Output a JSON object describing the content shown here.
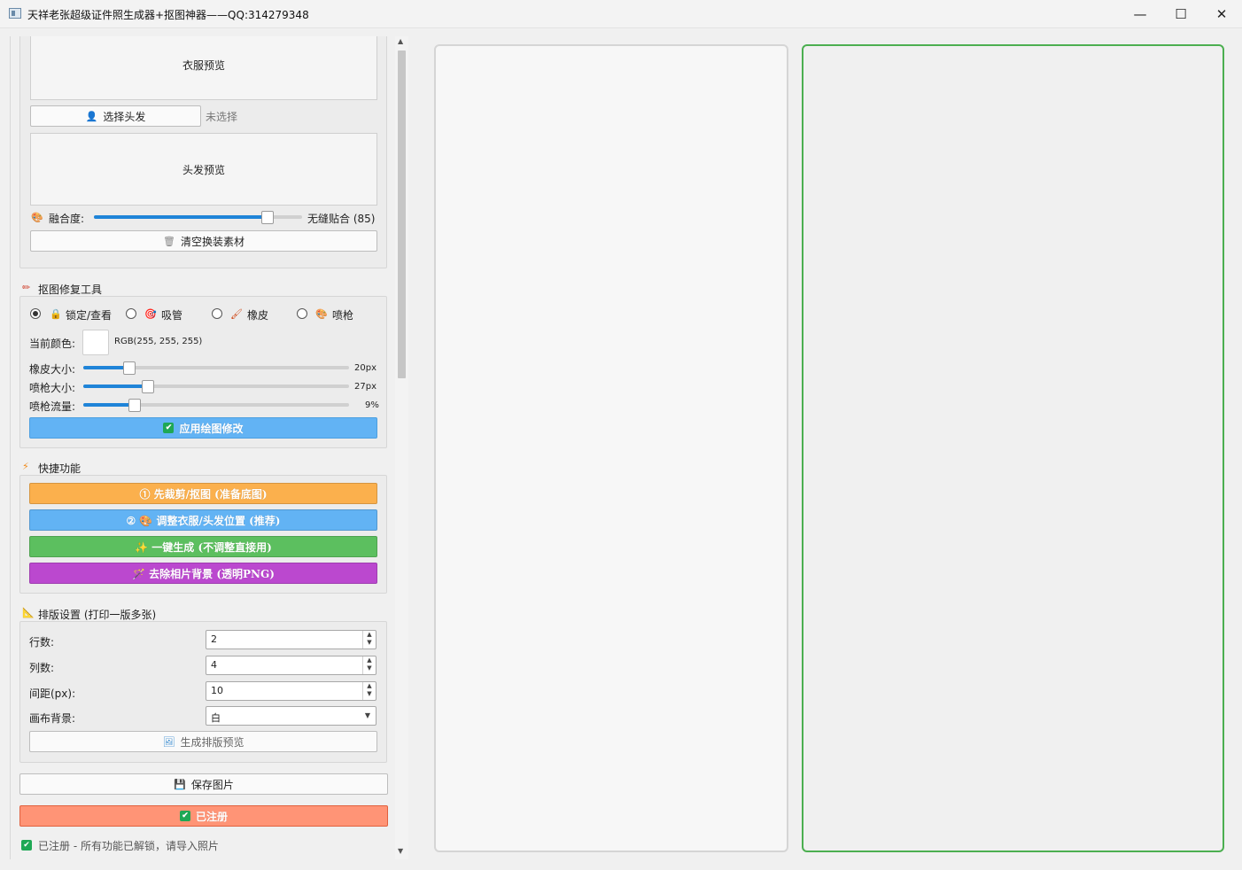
{
  "window": {
    "title": "天祥老张超级证件照生成器+抠图神器——QQ:314279348",
    "minimize": "—",
    "maximize": "☐",
    "close": "✕"
  },
  "clothes": {
    "preview_label": "衣服预览"
  },
  "hair": {
    "select_button": "选择头发",
    "status": "未选择",
    "preview_label": "头发预览"
  },
  "blend": {
    "label": "融合度:",
    "value_text": "无缝贴合 (85)",
    "level": 85
  },
  "clear_button": "清空换装素材",
  "repair": {
    "title": "抠图修复工具",
    "modes": [
      {
        "label": "锁定/查看",
        "checked": true
      },
      {
        "label": "吸管",
        "checked": false
      },
      {
        "label": "橡皮",
        "checked": false
      },
      {
        "label": "喷枪",
        "checked": false
      }
    ],
    "color_label": "当前颜色:",
    "color_value": "RGB(255, 255, 255)",
    "current_color": "#ffffff",
    "eraser_label": "橡皮大小:",
    "eraser_value": "20px",
    "eraser_level": 0.17,
    "spray_size_label": "喷枪大小:",
    "spray_size_value": "27px",
    "spray_size_level": 0.24,
    "spray_flow_label": "喷枪流量:",
    "spray_flow_value": "9%",
    "spray_flow_level": 0.19,
    "apply_button": "应用绘图修改"
  },
  "quick": {
    "title": "快捷功能",
    "buttons": [
      {
        "label": "① 先裁剪/抠图 (准备底图)",
        "color": "#fbb04d"
      },
      {
        "label": "② 🎨 调整衣服/头发位置 (推荐)",
        "color": "#62b3f4"
      },
      {
        "label": "✨ 一键生成 (不调整直接用)",
        "color": "#5cbf5f"
      },
      {
        "label": "🪄 去除相片背景 (透明PNG)",
        "color": "#bb48cf"
      }
    ]
  },
  "layout": {
    "title": "排版设置 (打印一版多张)",
    "rows_label": "行数:",
    "rows_value": "2",
    "cols_label": "列数:",
    "cols_value": "4",
    "gap_label": "间距(px):",
    "gap_value": "10",
    "bg_label": "画布背景:",
    "bg_value": "白",
    "preview_button": "生成排版预览"
  },
  "save_button": "保存图片",
  "registered_button": "已注册",
  "status_text": "已注册 - 所有功能已解锁，请导入照片",
  "colors": {
    "apply": "#62b3f4",
    "registered": "#ff9476",
    "right_canvas_border": "#4caf50",
    "slider_fill": "#1f84d8"
  }
}
